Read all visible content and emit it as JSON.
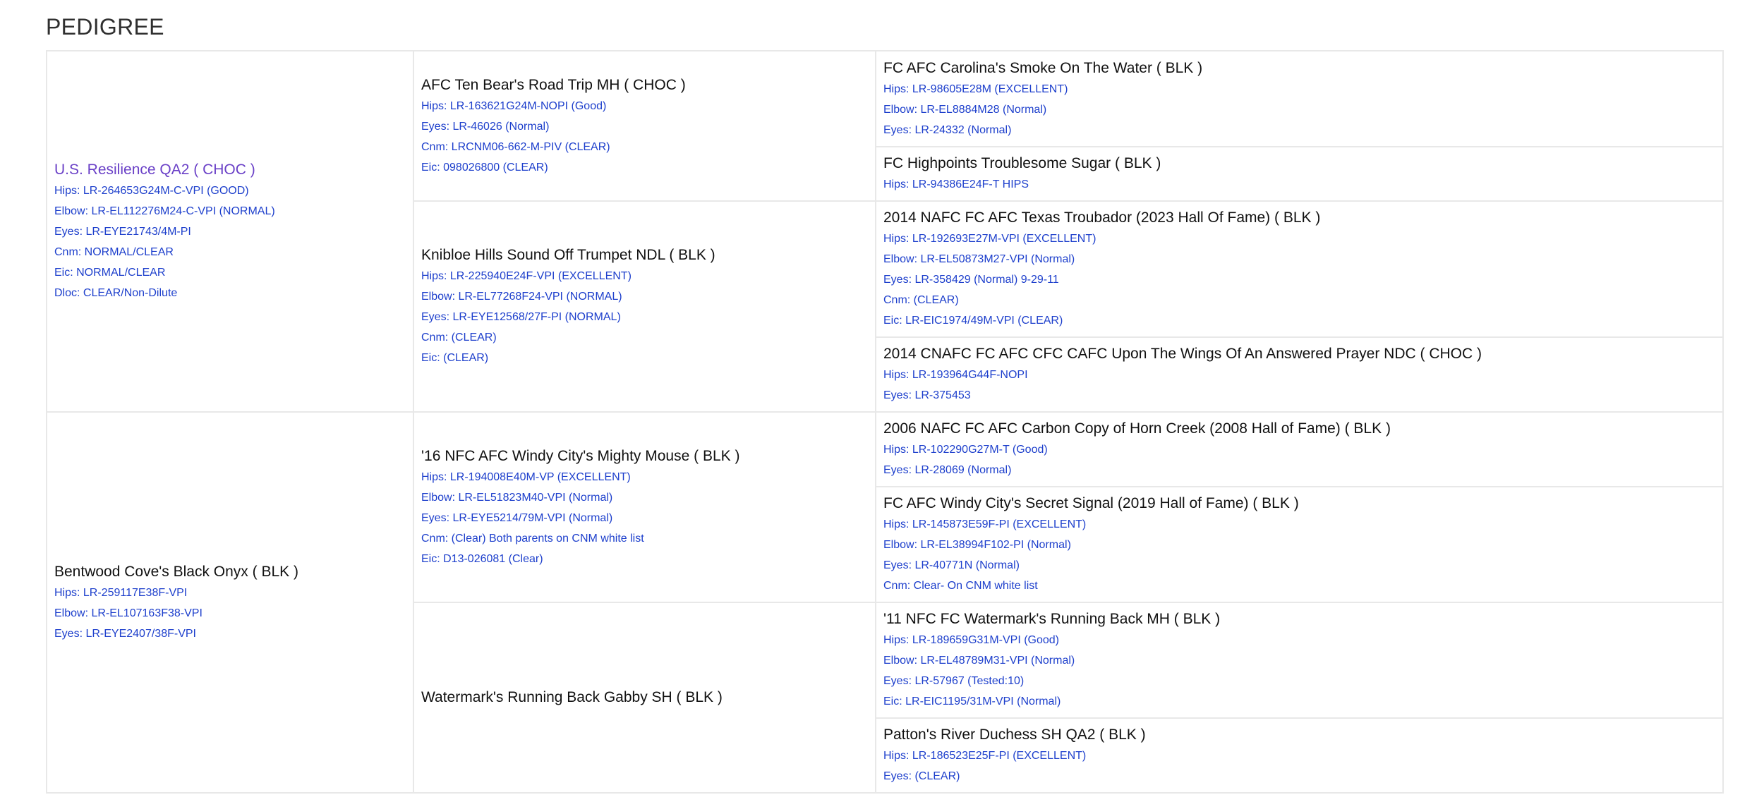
{
  "page": {
    "title": "PEDIGREE"
  },
  "sire": {
    "name": "U.S. Resilience QA2 ( CHOC )",
    "details": [
      "Hips: LR-264653G24M-C-VPI (GOOD)",
      "Elbow: LR-EL112276M24-C-VPI (NORMAL)",
      "Eyes: LR-EYE21743/4M-PI",
      "Cnm: NORMAL/CLEAR",
      "Eic: NORMAL/CLEAR",
      "Dloc: CLEAR/Non-Dilute"
    ],
    "sire": {
      "name": "AFC Ten Bear's Road Trip MH ( CHOC )",
      "details": [
        "Hips: LR-163621G24M-NOPI (Good)",
        "Eyes: LR-46026 (Normal)",
        "Cnm: LRCNM06-662-M-PIV (CLEAR)",
        "Eic: 098026800 (CLEAR)"
      ],
      "sire": {
        "name": "FC AFC Carolina's Smoke On The Water ( BLK )",
        "details": [
          "Hips: LR-98605E28M (EXCELLENT)",
          "Elbow: LR-EL8884M28 (Normal)",
          "Eyes: LR-24332 (Normal)"
        ]
      },
      "dam": {
        "name": "FC Highpoints Troublesome Sugar ( BLK )",
        "details": [
          "Hips: LR-94386E24F-T HIPS"
        ]
      }
    },
    "dam": {
      "name": "Knibloe Hills Sound Off Trumpet NDL ( BLK )",
      "details": [
        "Hips: LR-225940E24F-VPI (EXCELLENT)",
        "Elbow: LR-EL77268F24-VPI (NORMAL)",
        "Eyes: LR-EYE12568/27F-PI (NORMAL)",
        "Cnm: (CLEAR)",
        "Eic: (CLEAR)"
      ],
      "sire": {
        "name": "2014 NAFC FC AFC Texas Troubador (2023 Hall Of Fame) ( BLK )",
        "details": [
          "Hips: LR-192693E27M-VPI (EXCELLENT)",
          "Elbow: LR-EL50873M27-VPI (Normal)",
          "Eyes: LR-358429 (Normal) 9-29-11",
          "Cnm: (CLEAR)",
          "Eic: LR-EIC1974/49M-VPI (CLEAR)"
        ]
      },
      "dam": {
        "name": "2014 CNAFC FC AFC CFC CAFC Upon The Wings Of An Answered Prayer NDC ( CHOC )",
        "details": [
          "Hips: LR-193964G44F-NOPI",
          "Eyes: LR-375453"
        ]
      }
    }
  },
  "dam": {
    "name": "Bentwood Cove's Black Onyx ( BLK )",
    "details": [
      "Hips: LR-259117E38F-VPI",
      "Elbow: LR-EL107163F38-VPI",
      "Eyes: LR-EYE2407/38F-VPI"
    ],
    "sire": {
      "name": "'16 NFC AFC Windy City's Mighty Mouse ( BLK )",
      "details": [
        "Hips: LR-194008E40M-VP (EXCELLENT)",
        "Elbow: LR-EL51823M40-VPI (Normal)",
        "Eyes: LR-EYE5214/79M-VPI (Normal)",
        "Cnm: (Clear) Both parents on CNM white list",
        "Eic: D13-026081 (Clear)"
      ],
      "sire": {
        "name": "2006 NAFC FC AFC Carbon Copy of Horn Creek (2008 Hall of Fame) ( BLK )",
        "details": [
          "Hips: LR-102290G27M-T (Good)",
          "Eyes: LR-28069 (Normal)"
        ]
      },
      "dam": {
        "name": "FC AFC Windy City's Secret Signal (2019 Hall of Fame) ( BLK )",
        "details": [
          "Hips: LR-145873E59F-PI (EXCELLENT)",
          "Elbow: LR-EL38994F102-PI (Normal)",
          "Eyes: LR-40771N (Normal)",
          "Cnm: Clear- On CNM white list"
        ]
      }
    },
    "dam": {
      "name": "Watermark's Running Back Gabby SH ( BLK )",
      "details": [],
      "sire": {
        "name": "'11 NFC FC Watermark's Running Back MH ( BLK )",
        "details": [
          "Hips: LR-189659G31M-VPI (Good)",
          "Elbow: LR-EL48789M31-VPI (Normal)",
          "Eyes: LR-57967 (Tested:10)",
          "Eic: LR-EIC1195/31M-VPI (Normal)"
        ]
      },
      "dam": {
        "name": "Patton's River Duchess SH QA2 ( BLK )",
        "details": [
          "Hips: LR-186523E25F-PI (EXCELLENT)",
          "Eyes: (CLEAR)"
        ]
      }
    }
  }
}
